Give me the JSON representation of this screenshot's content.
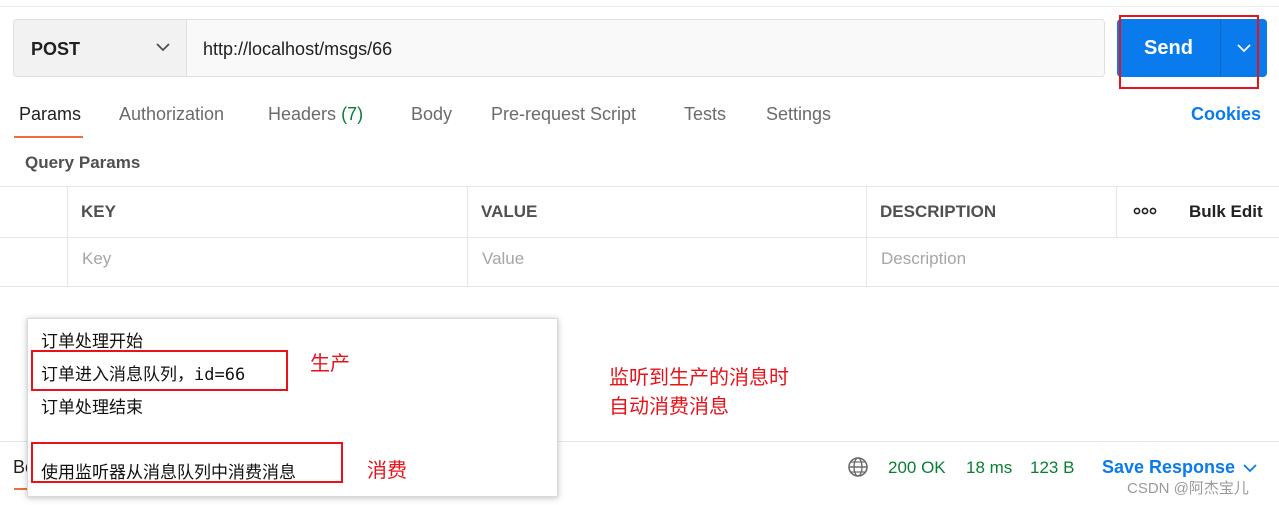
{
  "request": {
    "method": "POST",
    "url": "http://localhost/msgs/66",
    "send_label": "Send"
  },
  "tabs": {
    "params": "Params",
    "authorization": "Authorization",
    "headers": "Headers",
    "headers_count": "(7)",
    "body": "Body",
    "prerequest": "Pre-request Script",
    "tests": "Tests",
    "settings": "Settings",
    "cookies": "Cookies"
  },
  "params": {
    "section_title": "Query Params",
    "columns": {
      "key": "KEY",
      "value": "VALUE",
      "description": "DESCRIPTION"
    },
    "bulk_edit": "Bulk Edit",
    "placeholders": {
      "key": "Key",
      "value": "Value",
      "description": "Description"
    }
  },
  "response": {
    "body_tab": "Bo",
    "status": "200 OK",
    "time": "18 ms",
    "size": "123 B",
    "save_label": "Save Response"
  },
  "console": {
    "lines": [
      "订单处理开始",
      "订单进入消息队列，id=66",
      "订单处理结束",
      "使用监听器从消息队列中消费消息"
    ]
  },
  "annotations": {
    "produce": "生产",
    "consume": "消费",
    "note_line1": "监听到生产的消息时",
    "note_line2": "自动消费消息",
    "highlight_color": "#e8131a"
  },
  "watermark": "CSDN @阿杰宝儿",
  "colors": {
    "accent": "#097bed",
    "tab_active": "#f26b3a",
    "success": "#0a7f34"
  }
}
